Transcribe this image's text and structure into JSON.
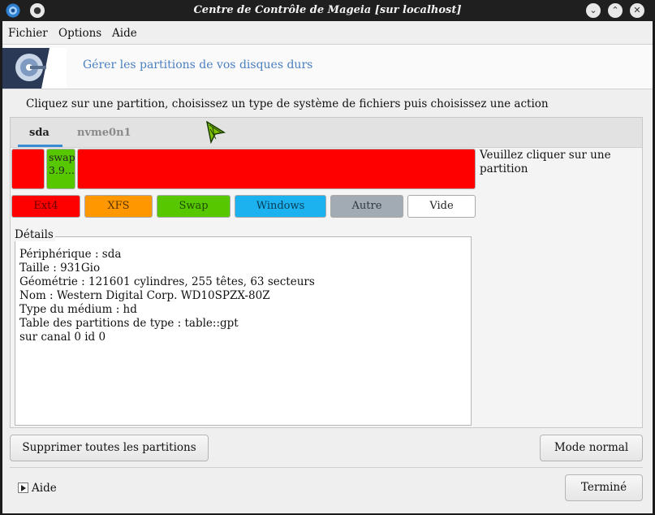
{
  "window": {
    "title": "Centre de Contrôle de Mageia [sur localhost]"
  },
  "menu": [
    "Fichier",
    "Options",
    "Aide"
  ],
  "banner": {
    "text": "Gérer les partitions de vos disques durs"
  },
  "instructions": "Cliquez sur une partition, choisissez un type de système de fichiers puis choisissez une action",
  "tabs": [
    {
      "label": "sda",
      "selected": true
    },
    {
      "label": "nvme0n1",
      "selected": false
    }
  ],
  "partitions": [
    {
      "label": "",
      "color": "#ff0000"
    },
    {
      "label_line1": "swap",
      "label_line2": "3.9...",
      "color": "#57c800"
    },
    {
      "label": "",
      "color": "#ff0000"
    }
  ],
  "hint": "Veuillez cliquer sur une partition",
  "fs_buttons": [
    {
      "label": "Ext4",
      "color": "#ff0000"
    },
    {
      "label": "XFS",
      "color": "#ff9800"
    },
    {
      "label": "Swap",
      "color": "#57c800"
    },
    {
      "label": "Windows",
      "color": "#1cb2ef"
    },
    {
      "label": "Autre",
      "color": "#a2aab4"
    },
    {
      "label": "Vide",
      "color": "#ffffff"
    }
  ],
  "details": {
    "label": "Détails",
    "lines": [
      "Périphérique : sda",
      "Taille : 931Gio",
      "Géométrie : 121601 cylindres, 255 têtes, 63 secteurs",
      "Nom : Western Digital Corp. WD10SPZX-80Z",
      "Type du médium : hd",
      "Table des partitions de type : table::gpt",
      "sur canal 0 id 0"
    ]
  },
  "buttons": {
    "delete_all": "Supprimer toutes les partitions",
    "normal_mode": "Mode normal",
    "done": "Terminé",
    "help": "Aide"
  }
}
